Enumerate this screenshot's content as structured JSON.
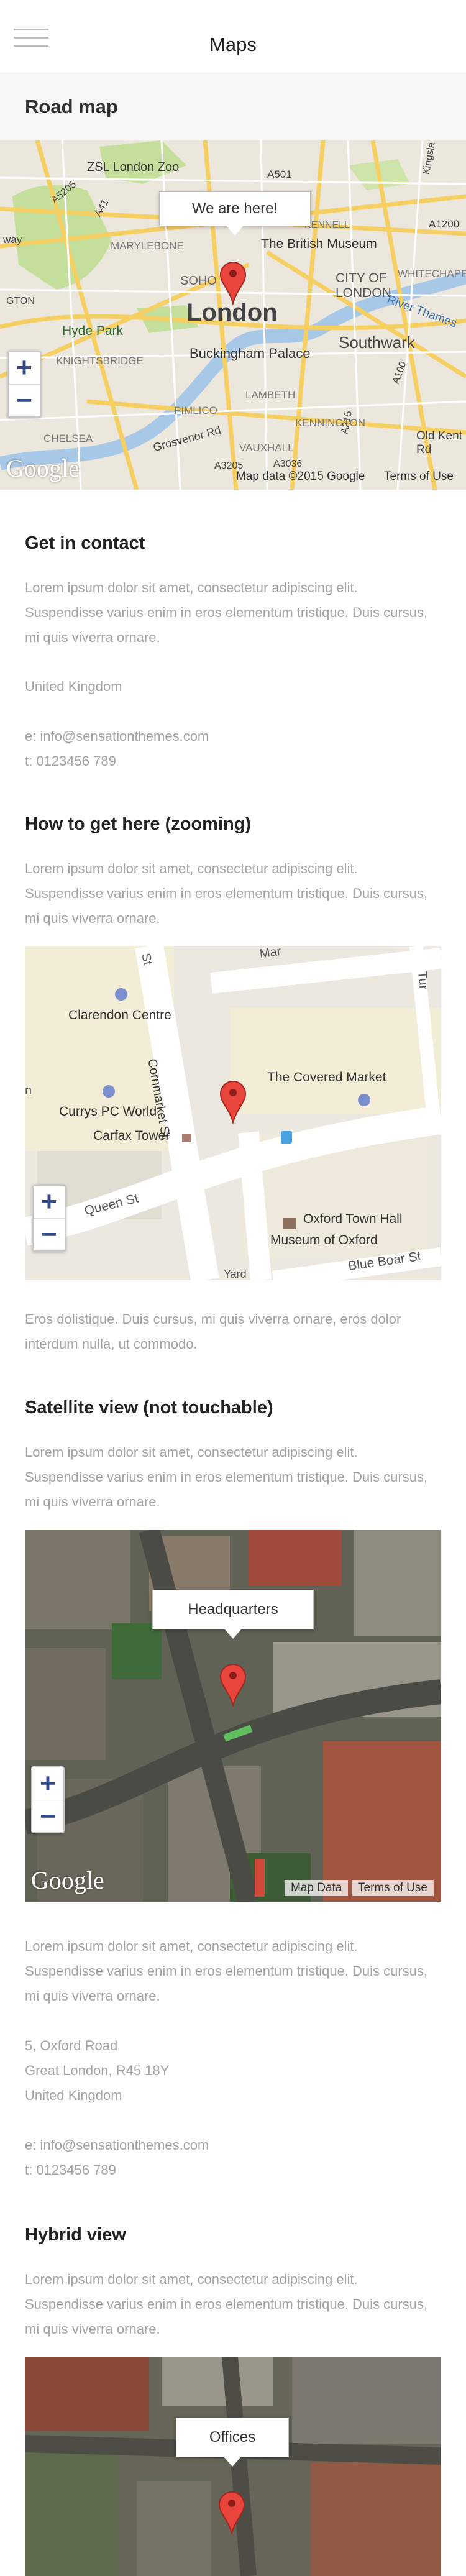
{
  "header": {
    "title": "Maps"
  },
  "section_title": "Road map",
  "road_map": {
    "callout": "We are here!",
    "labels": {
      "zsl": "ZSL London Zoo",
      "marylebone": "MARYLEBONE",
      "soho": "SOHO",
      "british_museum": "The British Museum",
      "city_of_london": "CITY OF LONDON",
      "london": "London",
      "hyde_park": "Hyde Park",
      "knightsbridge": "KNIGHTSBRIDGE",
      "buckingham": "Buckingham Palace",
      "southwark": "Southwark",
      "pimlico": "PIMLICO",
      "chelsea": "CHELSEA",
      "lambeth": "LAMBETH",
      "vauxhall": "VAUXHALL",
      "kennington": "KENNINGTON",
      "old_kent": "Old Kent Rd",
      "kennell": "KENNELL",
      "whitechapel": "WHITECHAPEL",
      "river_thames": "River Thames",
      "grosvenor": "Grosvenor Rd",
      "a501": "A501",
      "a1200": "A1200",
      "a3205": "A3205",
      "a3036": "A3036",
      "a215": "A215",
      "a100": "A100",
      "a5205": "A5205",
      "a41": "A41",
      "way": "way",
      "gton": "GTON",
      "kingsland": "Kingsla"
    },
    "attribution": "Map data ©2015 Google",
    "terms": "Terms of Use",
    "logo": "Google"
  },
  "contact": {
    "title": "Get in contact",
    "paragraph": "Lorem ipsum dolor sit amet, consectetur adipiscing elit. Suspendisse varius enim in eros elementum tristique. Duis cursus, mi quis viverra ornare.",
    "country": "United Kingdom",
    "email": "e: info@sensationthemes.com",
    "phone": "t: 0123456 789"
  },
  "zooming": {
    "title": "How to get here (zooming)",
    "paragraph": "Lorem ipsum dolor sit amet, consectetur adipiscing elit. Suspendisse varius enim in eros elementum tristique. Duis cursus, mi quis viverra ornare.",
    "labels": {
      "clarendon": "Clarendon Centre",
      "cornmarket": "Cornmarket St",
      "covered_market": "The Covered Market",
      "currys": "Currys PC World",
      "carfax": "Carfax Tower",
      "queen_st": "Queen St",
      "town_hall": "Oxford Town Hall",
      "museum": "Museum of Oxford",
      "blue_boar": "Blue Boar St",
      "st": "St",
      "mar": "Mar",
      "n": "n",
      "ura": "Tur",
      "yard": "Yard"
    },
    "after_text": "Eros dolistique. Duis cursus, mi quis viverra ornare, eros dolor interdum nulla, ut commodo."
  },
  "satellite": {
    "title": "Satellite view (not touchable)",
    "paragraph": "Lorem ipsum dolor sit amet, consectetur adipiscing elit. Suspendisse varius enim in eros elementum tristique. Duis cursus, mi quis viverra ornare.",
    "callout": "Headquarters",
    "attribution": "Map Data",
    "terms": "Terms of Use",
    "logo": "Google"
  },
  "address": {
    "paragraph": "Lorem ipsum dolor sit amet, consectetur adipiscing elit. Suspendisse varius enim in eros elementum tristique. Duis cursus, mi quis viverra ornare.",
    "street": "5, Oxford Road",
    "city": "Great London, R45 18Y",
    "country": "United Kingdom",
    "email": "e: info@sensationthemes.com",
    "phone": "t: 0123456 789"
  },
  "hybrid": {
    "title": "Hybrid view",
    "paragraph": "Lorem ipsum dolor sit amet, consectetur adipiscing elit. Suspendisse varius enim in eros elementum tristique. Duis cursus, mi quis viverra ornare.",
    "callout": "Offices"
  },
  "zoom_controls": {
    "plus": "+",
    "minus": "−"
  },
  "colors": {
    "accent": "#e8453c",
    "text_muted": "#a3a3a3",
    "road_yellow": "#f6cf63",
    "water": "#a8c8e8",
    "park": "#c4df9b"
  }
}
